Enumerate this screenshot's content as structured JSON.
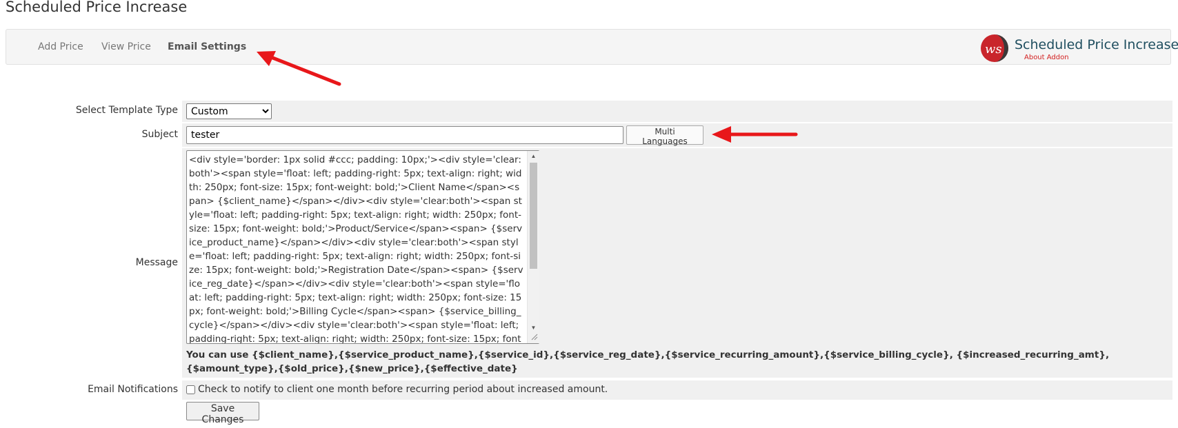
{
  "page": {
    "title": "Scheduled Price Increase"
  },
  "nav": {
    "items": [
      {
        "label": "Add Price"
      },
      {
        "label": "View Price"
      },
      {
        "label": "Email Settings"
      }
    ],
    "active_index": 2
  },
  "brand": {
    "title": "Scheduled Price Increase",
    "link": "About Addon",
    "logo_letters": "ws"
  },
  "form": {
    "template_type": {
      "label": "Select Template Type",
      "selected": "Custom"
    },
    "subject": {
      "label": "Subject",
      "value": "tester",
      "multi_languages_button": "Multi Languages"
    },
    "message": {
      "label": "Message",
      "value": "<div style='border: 1px solid #ccc; padding: 10px;'><div style='clear:both'><span style='float: left; padding-right: 5px; text-align: right; width: 250px; font-size: 15px; font-weight: bold;'>Client Name</span><span> {$client_name}</span></div><div style='clear:both'><span style='float: left; padding-right: 5px; text-align: right; width: 250px; font-size: 15px; font-weight: bold;'>Product/Service</span><span> {$service_product_name}</span></div><div style='clear:both'><span style='float: left; padding-right: 5px; text-align: right; width: 250px; font-size: 15px; font-weight: bold;'>Registration Date</span><span> {$service_reg_date}</span></div><div style='clear:both'><span style='float: left; padding-right: 5px; text-align: right; width: 250px; font-size: 15px; font-weight: bold;'>Billing Cycle</span><span> {$service_billing_cycle}</span></div><div style='clear:both'><span style='float: left; padding-right: 5px; text-align: right; width: 250px; font-size: 15px; font-weight: bold;'>Increase in",
      "help": "You can use {$client_name},{$service_product_name},{$service_id},{$service_reg_date},{$service_recurring_amount},{$service_billing_cycle}, {$increased_recurring_amt},{$amount_type},{$old_price},{$new_price},{$effective_date}"
    },
    "email_notifications": {
      "label": "Email Notifications",
      "checked": false,
      "text": "Check to notify to client one month before recurring period about increased amount."
    },
    "save_button": "Save Changes"
  },
  "colors": {
    "arrow": "#e8171a",
    "brand_title": "#1f4e5f",
    "brand_link": "#d21f1f",
    "row_background": "#f0f0f0"
  }
}
